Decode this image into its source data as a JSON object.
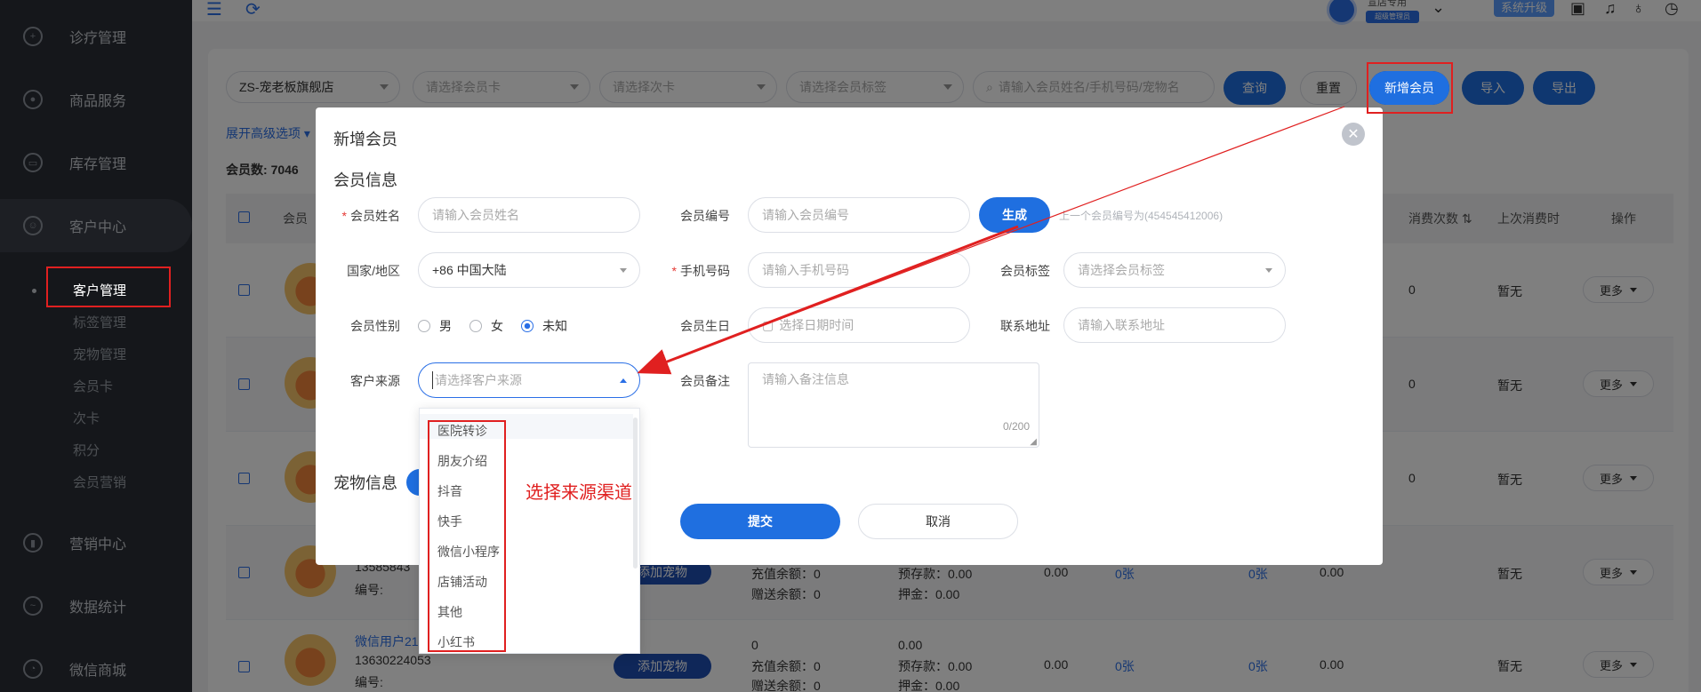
{
  "sidebar": {
    "items": [
      {
        "label": "诊疗管理",
        "icon": "clinic-icon"
      },
      {
        "label": "商品服务",
        "icon": "goods-icon"
      },
      {
        "label": "库存管理",
        "icon": "stock-icon"
      },
      {
        "label": "客户中心",
        "icon": "customer-icon"
      },
      {
        "label": "营销中心",
        "icon": "marketing-icon"
      },
      {
        "label": "数据统计",
        "icon": "stats-icon"
      },
      {
        "label": "微信商城",
        "icon": "wechat-icon"
      }
    ],
    "sub_items": [
      "客户管理",
      "标签管理",
      "宠物管理",
      "会员卡",
      "次卡",
      "积分",
      "会员营销"
    ]
  },
  "topbar": {
    "store_name_partial": "宣店专用",
    "role": "超级管理员",
    "upgrade": "系统升级"
  },
  "filters": {
    "store": "ZS-宠老板旗舰店",
    "card_placeholder": "请选择会员卡",
    "times_card_placeholder": "请选择次卡",
    "tag_placeholder": "请选择会员标签",
    "search_placeholder": "请输入会员姓名/手机号码/宠物名",
    "query": "查询",
    "reset": "重置",
    "add_member": "新增会员",
    "import": "导入",
    "export": "导出",
    "advanced": "展开高级选项"
  },
  "member_count": {
    "label": "会员数:",
    "value": "7046"
  },
  "table": {
    "headers": {
      "member": "会员",
      "consume_times": "消费次数",
      "last_consume": "上次消费时",
      "ops": "操作"
    },
    "rows": [
      {
        "count": "0",
        "last": "暂无",
        "more": "更多"
      },
      {
        "count": "0",
        "last": "暂无",
        "more": "更多"
      },
      {
        "count": "0",
        "last": "暂无",
        "more": "更多"
      },
      {
        "phone": "13585843",
        "code_label": "编号:",
        "pet_btn": "添加宠物",
        "recharge": "充值余额：0",
        "gift": "赠送余额：0",
        "prestore": "预存款：0.00",
        "deposit": "押金：0.00",
        "v1": "0.00",
        "card1": "0张",
        "card2": "0张",
        "v2": "0.00",
        "last": "暂无",
        "more": "更多"
      },
      {
        "name": "微信用户21",
        "phone": "13630224053",
        "code_label": "编号:",
        "pet_btn": "添加宠物",
        "top1": "0",
        "top2": "0.00",
        "recharge": "充值余额：0",
        "gift": "赠送余额：0",
        "prestore": "预存款：0.00",
        "deposit": "押金：0.00",
        "v1": "0.00",
        "card1": "0张",
        "card2": "0张",
        "v2": "0.00",
        "last": "暂无",
        "more": "更多"
      }
    ]
  },
  "modal": {
    "title": "新增会员",
    "section_info": "会员信息",
    "section_pet": "宠物信息",
    "fields": {
      "name_label": "会员姓名",
      "name_placeholder": "请输入会员姓名",
      "code_label": "会员编号",
      "code_placeholder": "请输入会员编号",
      "generate": "生成",
      "code_hint": "上一个会员编号为(454545412006)",
      "country_label": "国家/地区",
      "country_value": "+86 中国大陆",
      "phone_label": "手机号码",
      "phone_placeholder": "请输入手机号码",
      "tag_label": "会员标签",
      "tag_placeholder": "请选择会员标签",
      "gender_label": "会员性别",
      "gender_male": "男",
      "gender_female": "女",
      "gender_unknown": "未知",
      "birthday_label": "会员生日",
      "birthday_placeholder": "选择日期时间",
      "address_label": "联系地址",
      "address_placeholder": "请输入联系地址",
      "source_label": "客户来源",
      "source_placeholder": "请选择客户来源",
      "remark_label": "会员备注",
      "remark_placeholder": "请输入备注信息",
      "remark_count": "0/200"
    },
    "submit": "提交",
    "cancel": "取消"
  },
  "source_options": [
    "医院转诊",
    "朋友介绍",
    "抖音",
    "快手",
    "微信小程序",
    "店铺活动",
    "其他",
    "小红书"
  ],
  "annotation": "选择来源渠道",
  "colors": {
    "primary": "#1f6fe0",
    "annotation": "#e02020",
    "sidebar": "#2b2f36"
  }
}
